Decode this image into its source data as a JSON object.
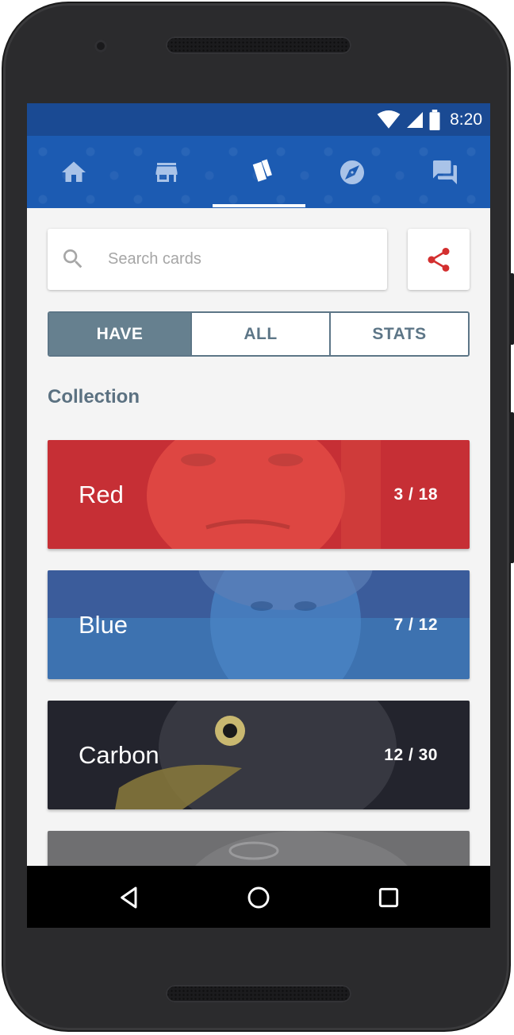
{
  "status_bar": {
    "time": "8:20",
    "icons": [
      "wifi-icon",
      "signal-icon",
      "battery-icon"
    ]
  },
  "nav_tabs": [
    {
      "name": "home",
      "icon": "home-icon",
      "active": false
    },
    {
      "name": "store",
      "icon": "store-icon",
      "active": false
    },
    {
      "name": "cards",
      "icon": "cards-icon",
      "active": true
    },
    {
      "name": "explore",
      "icon": "compass-icon",
      "active": false
    },
    {
      "name": "chat",
      "icon": "chat-icon",
      "active": false
    }
  ],
  "search": {
    "placeholder": "Search cards",
    "value": ""
  },
  "segments": {
    "have": "HAVE",
    "all": "ALL",
    "stats": "STATS",
    "selected": "HAVE"
  },
  "section": {
    "title": "Collection"
  },
  "collections": [
    {
      "name": "Red",
      "count": "3 / 18",
      "color": "#c62f35"
    },
    {
      "name": "Blue",
      "count": "7 / 12",
      "color": "#3d72b0"
    },
    {
      "name": "Carbon",
      "count": "12 / 30",
      "color": "#23242d"
    },
    {
      "name": "",
      "count": "",
      "color": "#6f6f71"
    }
  ],
  "colors": {
    "status_bar": "#1a4a93",
    "nav_bar": "#1c5bb2",
    "share_icon": "#d32f2f",
    "segment_active": "#66808f"
  }
}
